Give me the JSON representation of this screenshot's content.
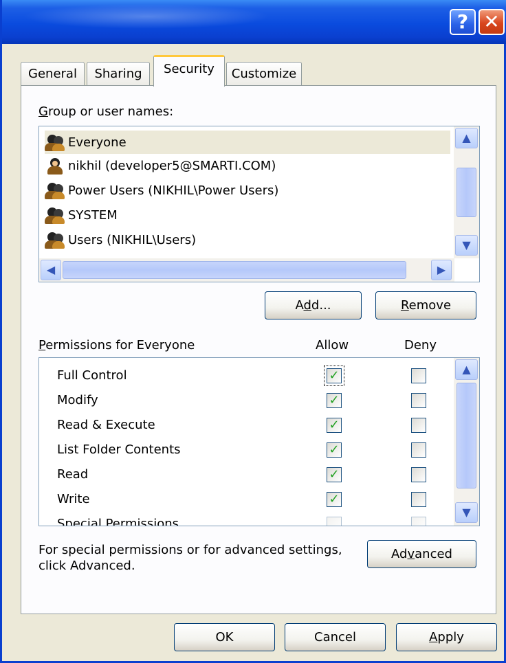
{
  "window": {
    "help_glyph": "?",
    "close_glyph": "✕"
  },
  "tabs": [
    "General",
    "Sharing",
    "Security",
    "Customize"
  ],
  "active_tab": "Security",
  "group_label": {
    "accel": "G",
    "rest": "roup or user names:"
  },
  "users": [
    {
      "name": "Everyone",
      "icon": "group-icon",
      "selected": true
    },
    {
      "name": "nikhil (developer5@SMARTI.COM)",
      "icon": "user-icon",
      "selected": false
    },
    {
      "name": "Power Users (NIKHIL\\Power Users)",
      "icon": "group-icon",
      "selected": false
    },
    {
      "name": "SYSTEM",
      "icon": "group-icon",
      "selected": false
    },
    {
      "name": "Users (NIKHIL\\Users)",
      "icon": "group-icon",
      "selected": false
    }
  ],
  "buttons": {
    "add": {
      "pre": "A",
      "accel": "d",
      "post": "d..."
    },
    "remove": {
      "pre": "",
      "accel": "R",
      "post": "emove"
    },
    "advanced": {
      "pre": "Ad",
      "accel": "v",
      "post": "anced"
    },
    "ok": "OK",
    "cancel": "Cancel",
    "apply": {
      "pre": "",
      "accel": "A",
      "post": "pply"
    }
  },
  "permissions_label": {
    "accel": "P",
    "rest": "ermissions for Everyone"
  },
  "allow_header": "Allow",
  "deny_header": "Deny",
  "permissions": [
    {
      "name": "Full Control",
      "allow": true,
      "deny": false
    },
    {
      "name": "Modify",
      "allow": true,
      "deny": false
    },
    {
      "name": "Read & Execute",
      "allow": true,
      "deny": false
    },
    {
      "name": "List Folder Contents",
      "allow": true,
      "deny": false
    },
    {
      "name": "Read",
      "allow": true,
      "deny": false
    },
    {
      "name": "Write",
      "allow": true,
      "deny": false
    },
    {
      "name": "Special Permissions",
      "allow": false,
      "deny": false
    }
  ],
  "advanced_note": [
    "For special permissions or for advanced settings,",
    "click Advanced."
  ],
  "colors": {
    "titlebar": "#0a4bde",
    "dialog_bg": "#ece9d8",
    "check": "#21a121",
    "tab_highlight": "#ffc83c"
  }
}
